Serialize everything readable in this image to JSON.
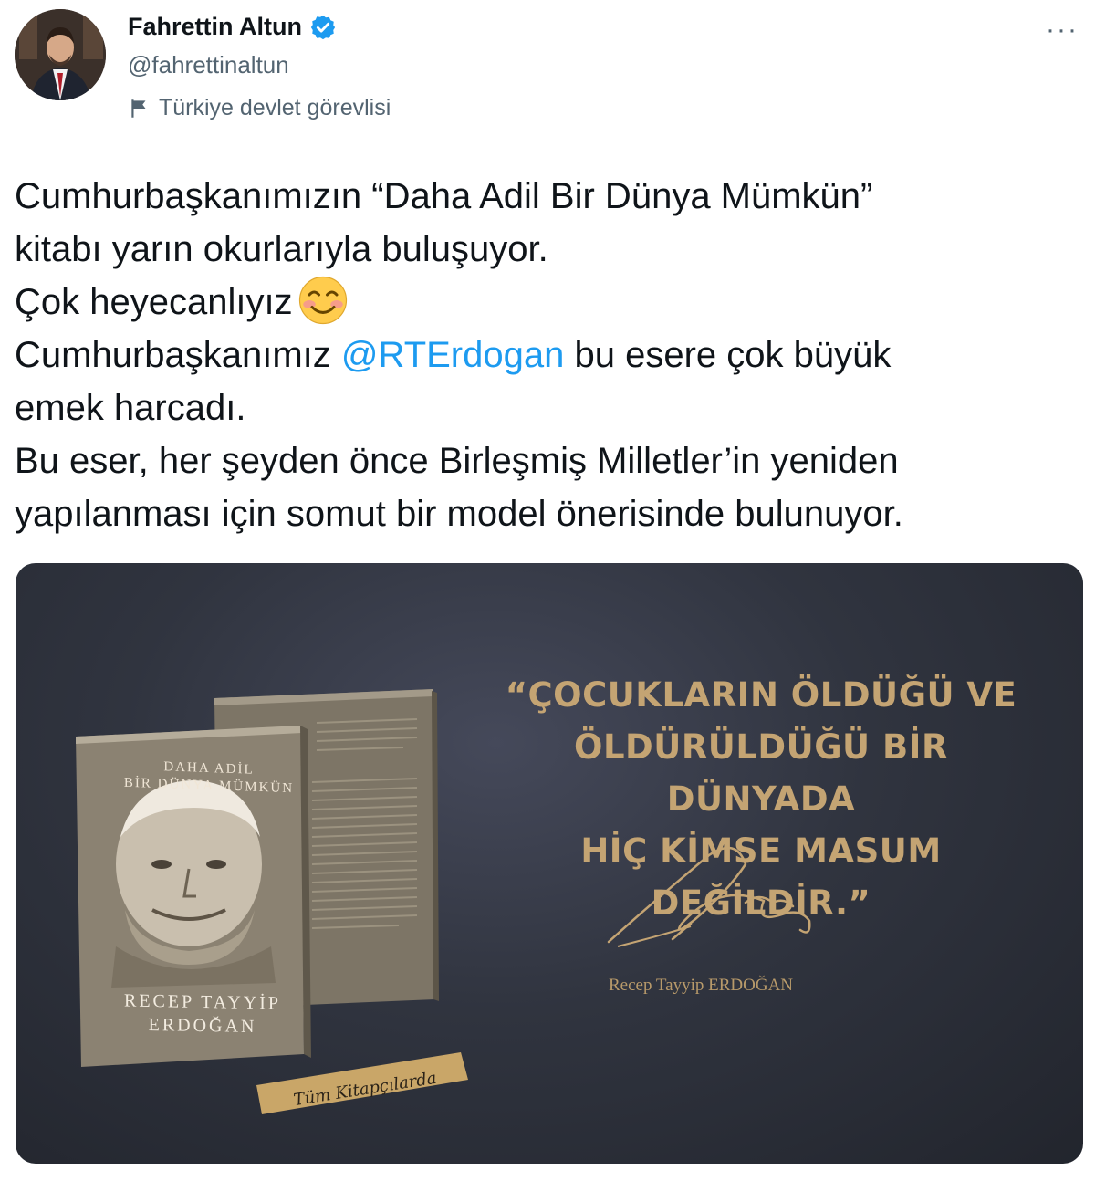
{
  "author": {
    "name": "Fahrettin Altun",
    "handle": "@fahrettinaltun",
    "label": "Türkiye devlet görevlisi",
    "verified_color": "#1d9bf0"
  },
  "more_menu": "···",
  "tweet": {
    "lines": [
      "Cumhurbaşkanımızın “Daha Adil Bir Dünya Mümkün”",
      "kitabı yarın okurlarıyla buluşuyor.",
      "Çok heyecanlıyız"
    ],
    "line4_before": "Cumhurbaşkanımız ",
    "mention": "@RTErdogan",
    "line4_after": " bu esere çok büyük",
    "lines_after": [
      "emek harcadı.",
      "Bu eser, her şeyden önce Birleşmiş Milletler’in yeniden",
      "yapılanması için somut bir model önerisinde bulunuyor."
    ],
    "emoji": "smiling-face-with-smiling-eyes"
  },
  "media": {
    "quote_lines": [
      "“ÇOCUKLARIN ÖLDÜĞÜ VE",
      "ÖLDÜRÜLDÜĞÜ BİR DÜNYADA",
      "HİÇ KİMSE MASUM DEĞİLDİR.”"
    ],
    "signature_name": "Recep Tayyip ERDOĞAN",
    "book_title_lines": [
      "DAHA ADİL",
      "BİR DÜNYA MÜMKÜN"
    ],
    "book_author_lines": [
      "RECEP TAYYİP",
      "ERDOĞAN"
    ],
    "tag": "Tüm Kitapçılarda",
    "accent_color": "#c4a473"
  }
}
